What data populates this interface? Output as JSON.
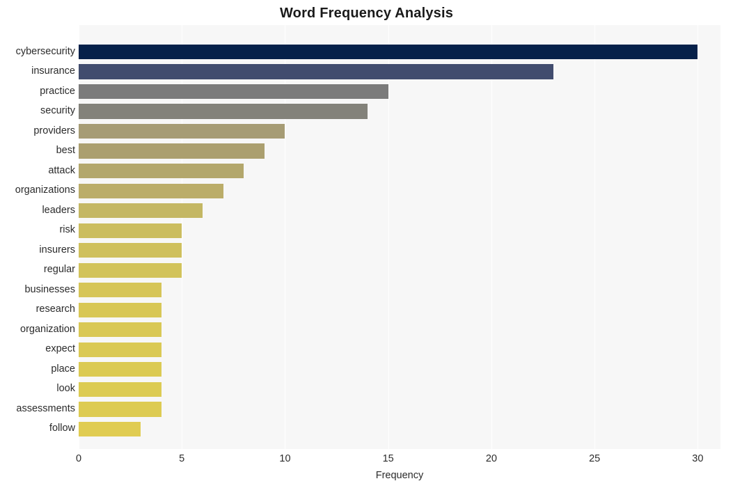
{
  "chart_data": {
    "type": "bar",
    "orientation": "horizontal",
    "title": "Word Frequency Analysis",
    "xlabel": "Frequency",
    "ylabel": "",
    "categories": [
      "cybersecurity",
      "insurance",
      "practice",
      "security",
      "providers",
      "best",
      "attack",
      "organizations",
      "leaders",
      "risk",
      "insurers",
      "regular",
      "businesses",
      "research",
      "organization",
      "expect",
      "place",
      "look",
      "assessments",
      "follow"
    ],
    "values": [
      30,
      23,
      15,
      14,
      10,
      9,
      8,
      7,
      6,
      5,
      5,
      5,
      4,
      4,
      4,
      4,
      4,
      4,
      4,
      3
    ],
    "bar_colors": [
      "#06214a",
      "#414c6e",
      "#7b7b7b",
      "#83827a",
      "#a69c75",
      "#ab9f6f",
      "#b3a76c",
      "#bbad69",
      "#c4b763",
      "#cbbd5f",
      "#cfc05d",
      "#d2c35b",
      "#d6c558",
      "#d8c756",
      "#d9c855",
      "#dac954",
      "#dbca53",
      "#dccb53",
      "#ddcb52",
      "#e0cc52"
    ],
    "xticks": [
      0,
      5,
      10,
      15,
      20,
      25,
      30
    ],
    "xtick_labels": [
      "0",
      "5",
      "10",
      "15",
      "20",
      "25",
      "30"
    ],
    "xlim": [
      0,
      31.1
    ],
    "grid": true,
    "grid_axis": "x",
    "legend": null,
    "plot_background": "#f7f7f7",
    "figure_background": "#ffffff",
    "gridline_color": "#ffffff",
    "title_color": "#1a1a1a",
    "tick_label_color": "#2b2b2b"
  }
}
